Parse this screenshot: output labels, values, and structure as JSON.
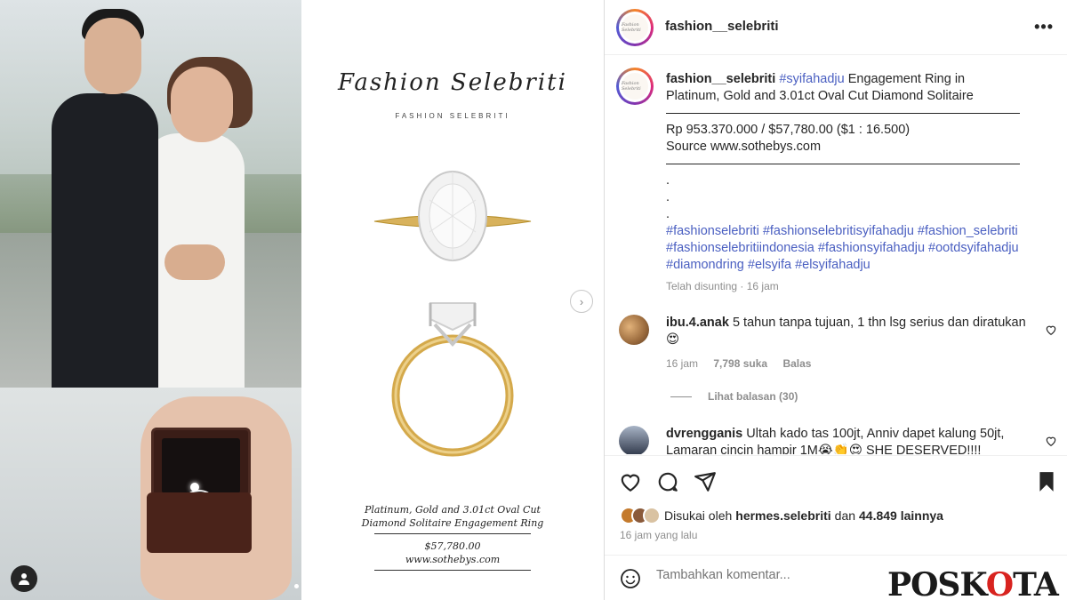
{
  "post": {
    "account": "fashion__selebriti",
    "avatar_text": "Fashion Selebriti",
    "caption": {
      "username": "fashion__selebriti",
      "lead_tag": "#syifahadju",
      "lead_text": " Engagement Ring in Platinum, Gold and 3.01ct Oval Cut Diamond Solitaire",
      "price": "Rp 953.370.000 / $57,780.00 ($1 : 16.500)",
      "source": "Source www.sothebys.com",
      "dot1": ".",
      "dot2": ".",
      "dot3": ".",
      "hashtags": "#fashionselebriti #fashionselebritisyifahadju #fashion_selebriti #fashionselebritiindonesia #fashionsyifahadju #ootdsyifahadju #diamondring #elsyifa #elsyifahadju",
      "edited": "Telah disunting · 16 jam"
    },
    "media_card": {
      "brand_script": "Fashion Selebriti",
      "brand_small": "FASHION SELEBRITI",
      "line1": "Platinum, Gold and 3.01ct Oval Cut",
      "line2": "Diamond Solitaire Engagement Ring",
      "price": "$57,780.00",
      "url": "www.sothebys.com"
    },
    "next_label": "›",
    "more_label": "•••"
  },
  "comments": [
    {
      "username": "ibu.4.anak",
      "text": " 5 tahun tanpa tujuan, 1 thn lsg serius dan diratukan 😍",
      "time": "16 jam",
      "likes": "7,798 suka",
      "reply": "Balas",
      "view_replies": "Lihat balasan (30)"
    },
    {
      "username": "dvrengganis",
      "text": " Ultah kado tas 100jt, Anniv dapet kalung 50jt, Lamaran cincin hampir 1M😭👏😍 SHE DESERVED!!!!"
    }
  ],
  "likes": {
    "prefix": "Disukai oleh",
    "user": "hermes.selebriti",
    "middle": "dan",
    "count": "44.849 lainnya"
  },
  "timestamp": "16 jam yang lalu",
  "add_comment": {
    "placeholder": "Tambahkan komentar..."
  },
  "watermark": {
    "part1": "POSK",
    "part2": "O",
    "part3": "TA"
  },
  "colors": {
    "hashtag": "#4a5fc1",
    "muted": "#8e8e8e",
    "text": "#262626",
    "watermark_red": "#d8231f"
  },
  "icons": [
    "user-icon",
    "chevron-right-icon",
    "more-icon",
    "heart-icon",
    "comment-icon",
    "share-icon",
    "bookmark-icon",
    "emoji-icon"
  ]
}
